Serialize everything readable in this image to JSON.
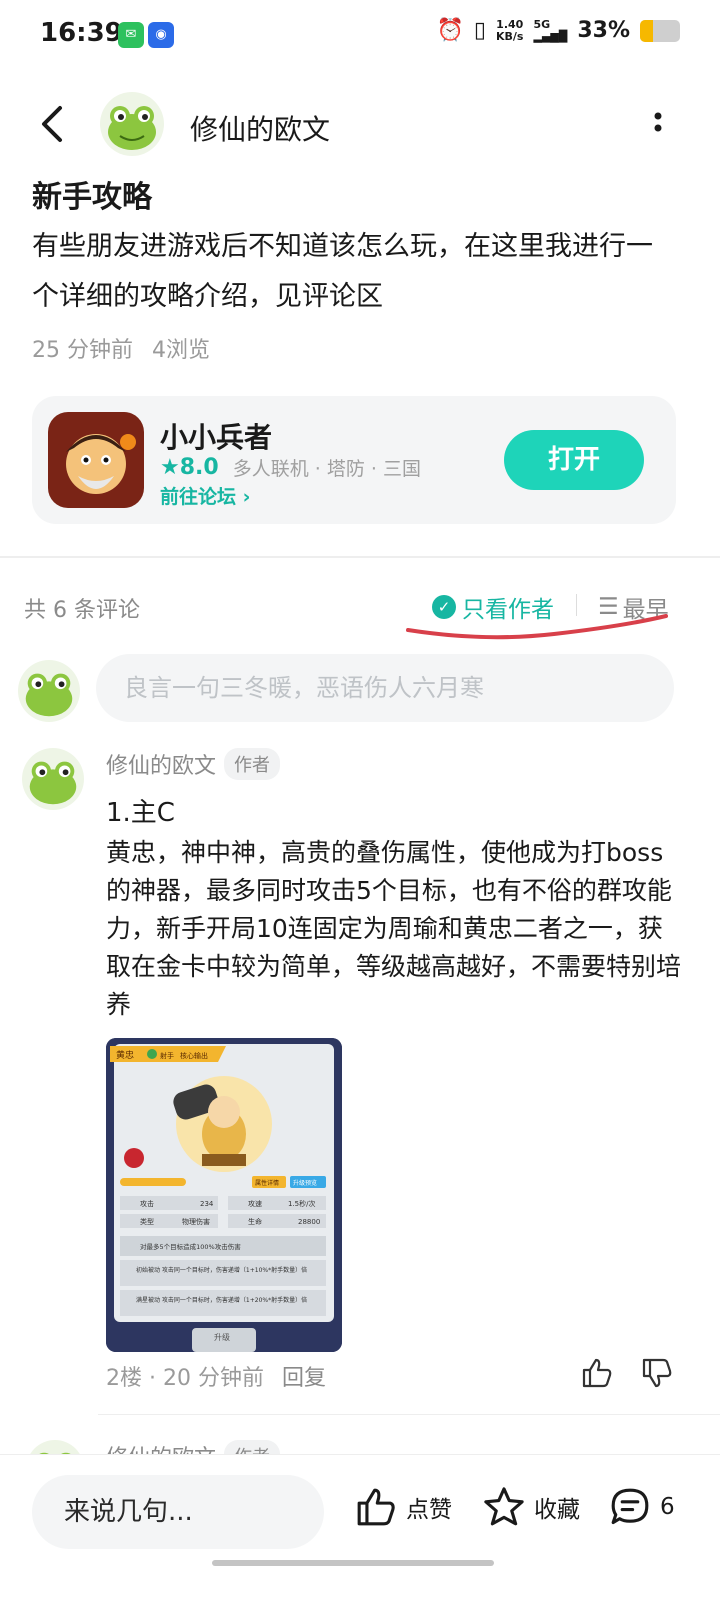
{
  "status_bar": {
    "time": "16:39",
    "speed_value": "1.40",
    "speed_unit": "KB/s",
    "signal_label": "5G",
    "battery_text": "33%",
    "battery_level": 0.33
  },
  "header": {
    "author_name": "修仙的欧文"
  },
  "post": {
    "title": "新手攻略",
    "body": "有些朋友进游戏后不知道该怎么玩，在这里我进行一个详细的攻略介绍，见评论区",
    "time": "25 分钟前",
    "views": "4浏览"
  },
  "game_card": {
    "name": "小小兵者",
    "rating": "8.0",
    "tags": "多人联机 · 塔防 · 三国",
    "forum_link": "前往论坛",
    "open_button": "打开"
  },
  "comments_header": {
    "count_text": "共 6 条评论",
    "only_author": "只看作者",
    "sort_label": "最早"
  },
  "comment_input": {
    "placeholder": "良言一句三冬暖，恶语伤人六月寒"
  },
  "comment": {
    "author": "修仙的欧文",
    "badge": "作者",
    "heading": "1.主C",
    "body": "黄忠，神中神，高贵的叠伤属性，使他成为打boss的神器，最多同时攻击5个目标，也有不俗的群攻能力，新手开局10连固定为周瑜和黄忠二者之一，获取在金卡中较为简单，等级越高越好，不需要特别培养",
    "image": {
      "hero_name": "黄忠",
      "role_tag": "射手",
      "role_desc": "核心输出",
      "stats": [
        {
          "label": "攻击",
          "value": "234"
        },
        {
          "label": "攻速",
          "value": "1.5秒/次"
        },
        {
          "label": "类型",
          "value": "物理伤害"
        },
        {
          "label": "生命",
          "value": "28800"
        }
      ],
      "skill_main": "对最多5个目标造成100%攻击伤害",
      "skill_1": "初始被动 攻击同一个目标时，伤害递增（1+10%*射手数量）倍",
      "skill_2": "满星被动 攻击同一个目标时，伤害递增（1+20%*射手数量）倍",
      "btn_left": "属性详情",
      "btn_right": "升级预览",
      "bottom_btn": "升级"
    },
    "floor": "2楼",
    "time": "20 分钟前",
    "reply": "回复"
  },
  "next_comment": {
    "author": "修仙的欧文",
    "badge": "作者"
  },
  "bottom_bar": {
    "input_text": "来说几句...",
    "like_label": "点赞",
    "fav_label": "收藏",
    "comment_count": "6"
  }
}
